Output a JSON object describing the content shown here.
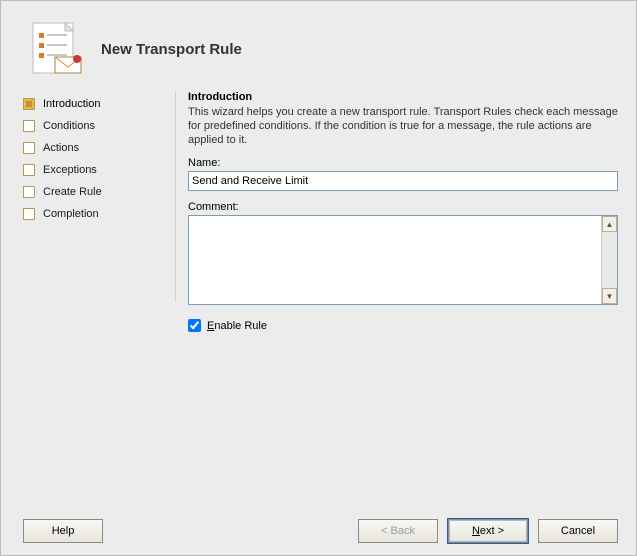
{
  "header": {
    "title": "New Transport Rule"
  },
  "sidebar": {
    "items": [
      {
        "label": "Introduction",
        "active": true
      },
      {
        "label": "Conditions",
        "active": false
      },
      {
        "label": "Actions",
        "active": false
      },
      {
        "label": "Exceptions",
        "active": false
      },
      {
        "label": "Create Rule",
        "active": false
      },
      {
        "label": "Completion",
        "active": false
      }
    ]
  },
  "main": {
    "section_title": "Introduction",
    "section_desc": "This wizard helps you create a new transport rule. Transport Rules check each message for predefined conditions. If the condition is true for a message, the rule actions are applied to it.",
    "name_label": "Name:",
    "name_value": "Send and Receive Limit",
    "comment_label": "Comment:",
    "comment_value": "",
    "enable_label_prefix": "E",
    "enable_label_rest": "nable Rule",
    "enable_checked": true
  },
  "buttons": {
    "help": "Help",
    "back": "< Back",
    "next_prefix": "N",
    "next_rest": "ext >",
    "cancel": "Cancel"
  },
  "icons": {
    "wizard": "document-list-icon"
  }
}
